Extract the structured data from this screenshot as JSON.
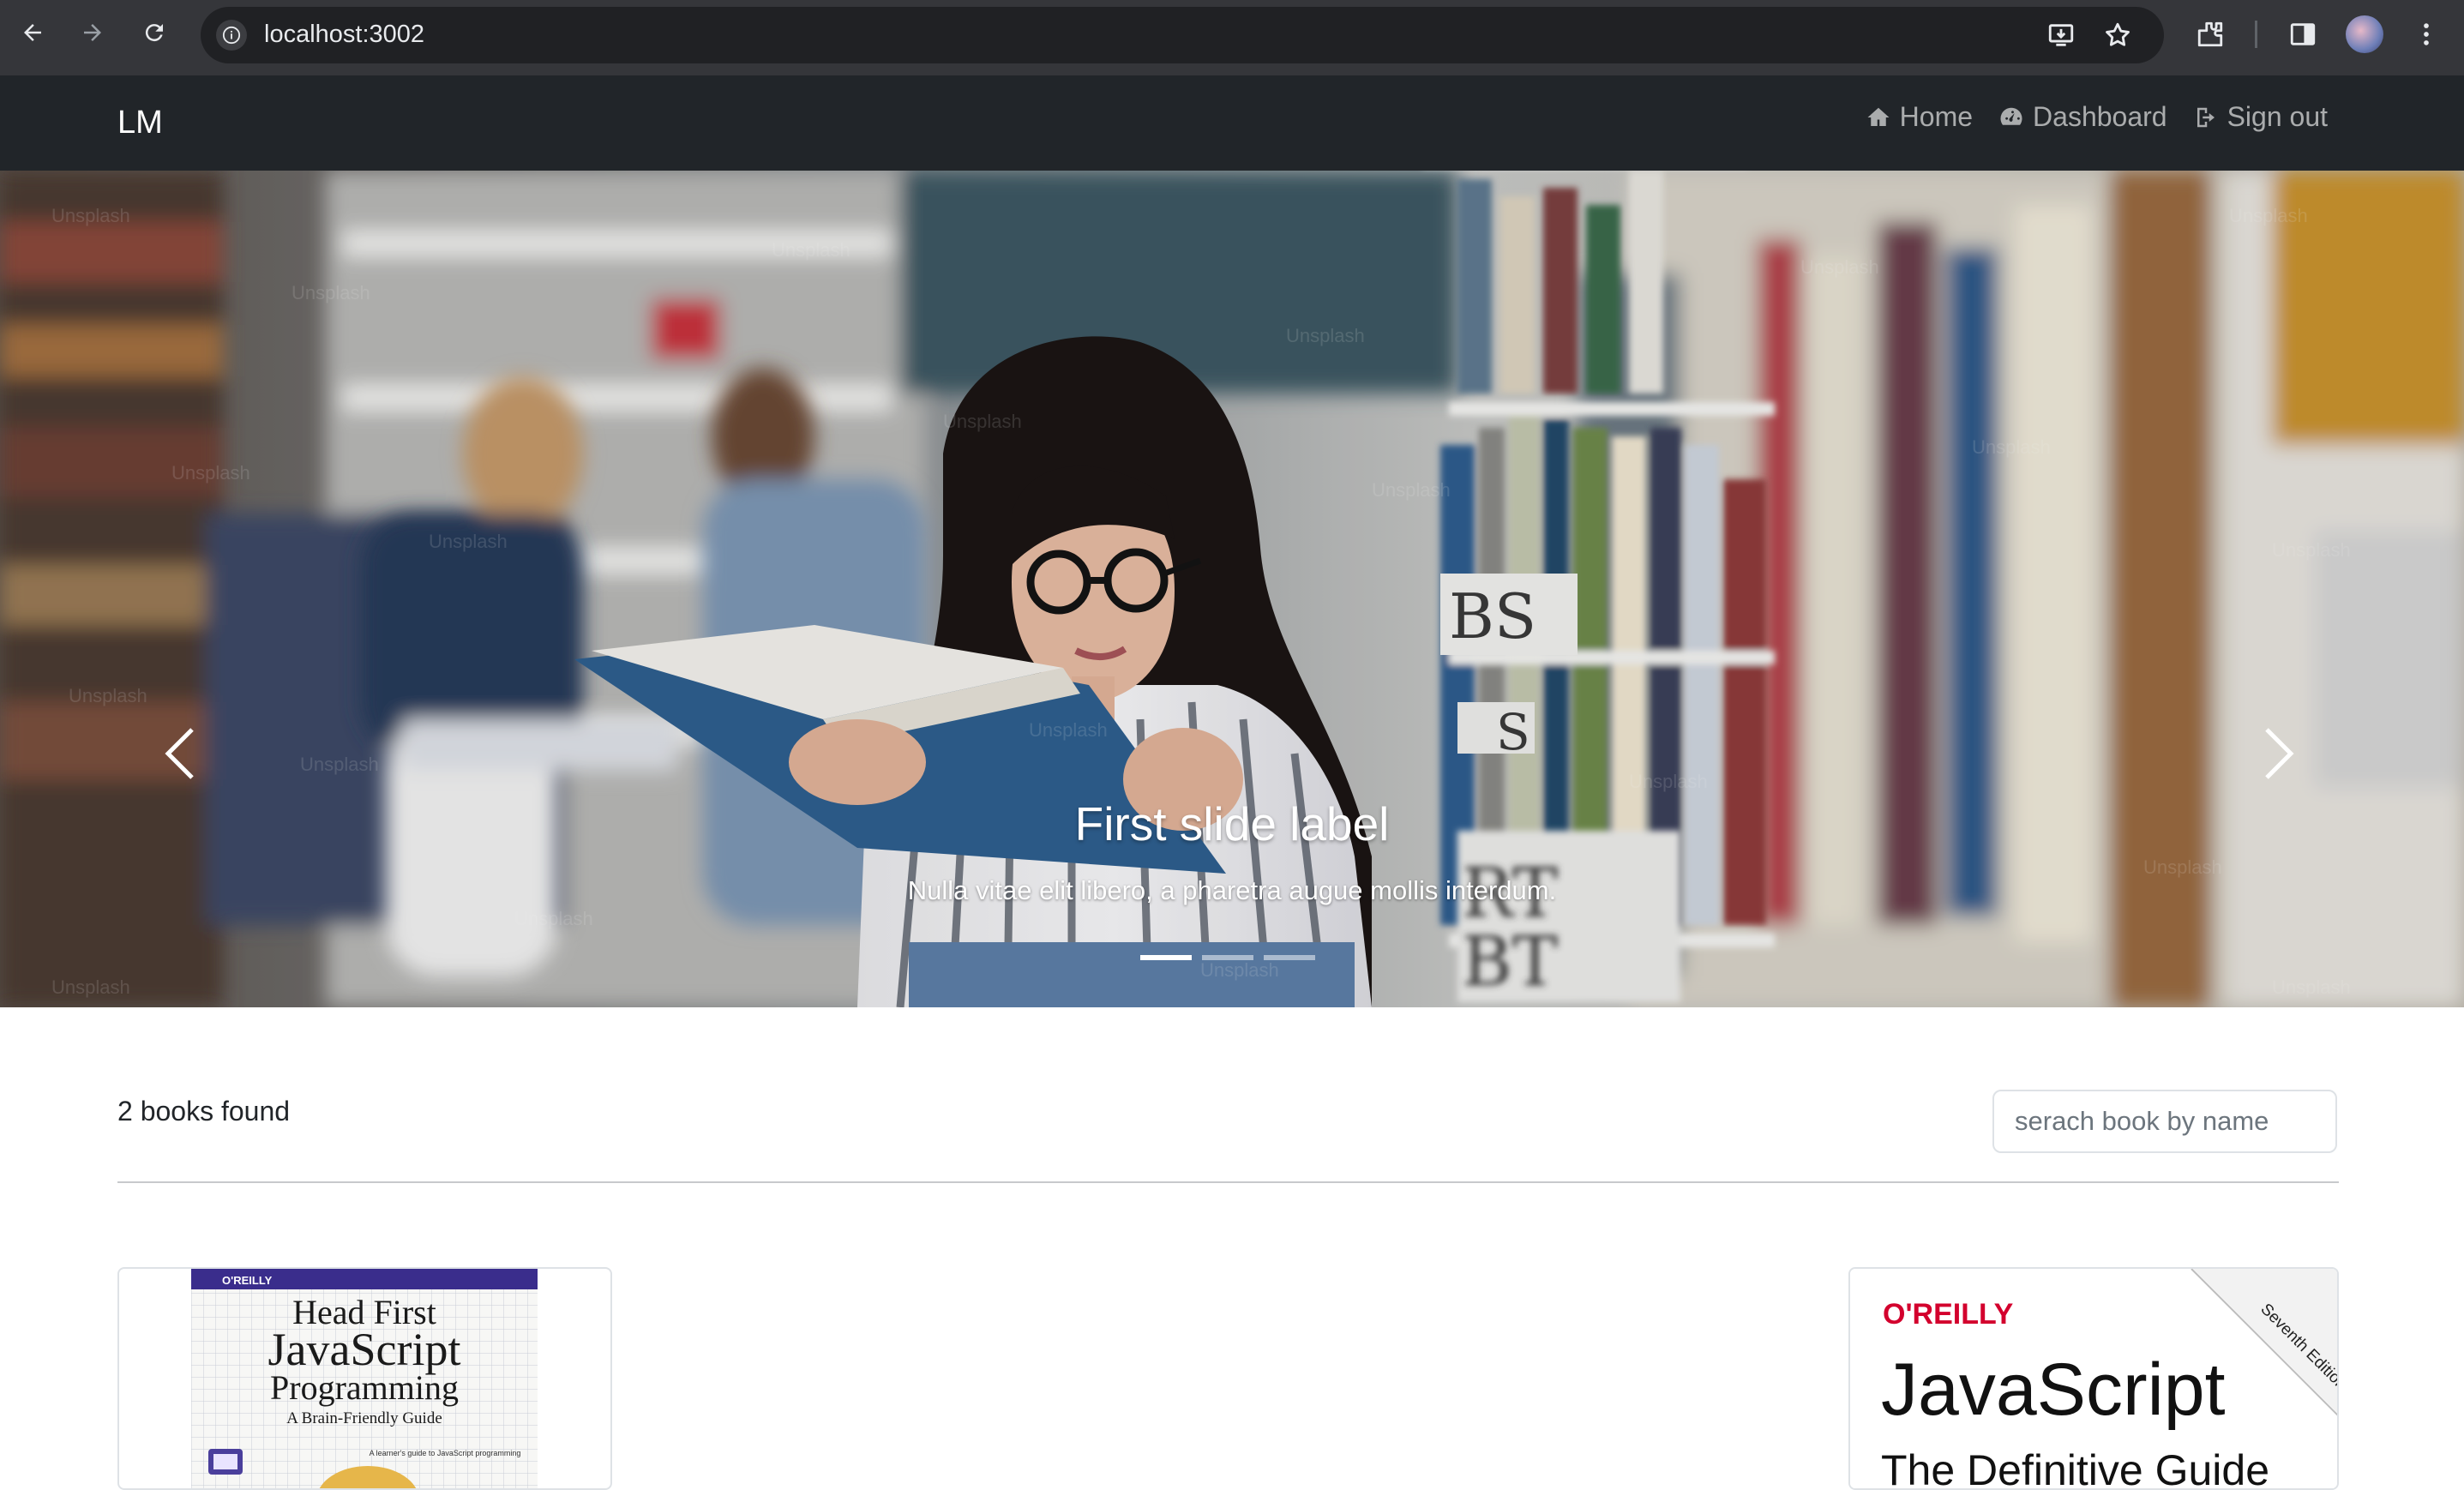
{
  "browser": {
    "url": "localhost:3002",
    "icons": [
      "back-arrow-icon",
      "forward-arrow-icon",
      "reload-icon",
      "site-info-icon",
      "install-app-icon",
      "bookmark-star-icon",
      "extensions-puzzle-icon",
      "side-panel-icon",
      "profile-avatar",
      "more-menu-icon"
    ]
  },
  "navbar": {
    "brand": "LM",
    "links": [
      {
        "label": "Home",
        "icon": "home-icon"
      },
      {
        "label": "Dashboard",
        "icon": "dashboard-gauge-icon"
      },
      {
        "label": "Sign out",
        "icon": "sign-out-icon"
      }
    ]
  },
  "carousel": {
    "title": "First slide label",
    "text": "Nulla vitae elit libero, a pharetra augue mollis interdum.",
    "slide_count": 3,
    "active_index": 0,
    "controls": [
      "chevron-left-icon",
      "chevron-right-icon"
    ]
  },
  "results": {
    "count_text": "2 books found",
    "search_placeholder": "serach book by name"
  },
  "books": [
    {
      "publisher": "O'REILLY",
      "title_line1": "Head First",
      "title_line2": "JavaScript",
      "title_line3": "Programming",
      "subtitle": "A Brain-Friendly Guide",
      "blurb": "A learner's guide to JavaScript programming"
    },
    {
      "publisher": "O'REILLY",
      "title": "JavaScript",
      "subtitle": "The Definitive Guide",
      "edition": "Seventh Edition"
    }
  ],
  "colors": {
    "navbar_bg": "#212529",
    "chrome_bg": "#35363a",
    "omnibox_bg": "#202124",
    "head_first_purple": "#3a2d8c",
    "definitive_guide_red": "#d3002d"
  }
}
